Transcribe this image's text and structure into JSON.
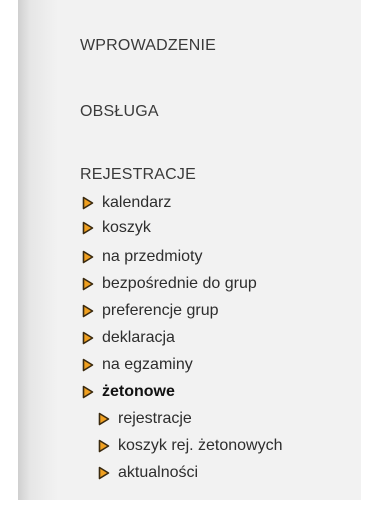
{
  "menu": {
    "sections": [
      {
        "label": "WPROWADZENIE"
      },
      {
        "label": "OBSŁUGA"
      },
      {
        "label": "REJESTRACJE"
      }
    ],
    "registration_items": [
      {
        "label": "kalendarz"
      },
      {
        "label": "koszyk"
      },
      {
        "label": "na przedmioty"
      },
      {
        "label": "bezpośrednie do grup"
      },
      {
        "label": "preferencje grup"
      },
      {
        "label": "deklaracja"
      },
      {
        "label": "na egzaminy"
      },
      {
        "label": "żetonowe",
        "active": true
      }
    ],
    "token_subitems": [
      {
        "label": "rejestracje"
      },
      {
        "label": "koszyk rej. żetonowych"
      },
      {
        "label": "aktualności"
      }
    ]
  },
  "colors": {
    "bullet_fill": "#f0a020",
    "bullet_outline": "#3a2a10",
    "panel_bg": "#f2f2f2"
  },
  "icons": {
    "bullet": "play-arrow-icon"
  }
}
